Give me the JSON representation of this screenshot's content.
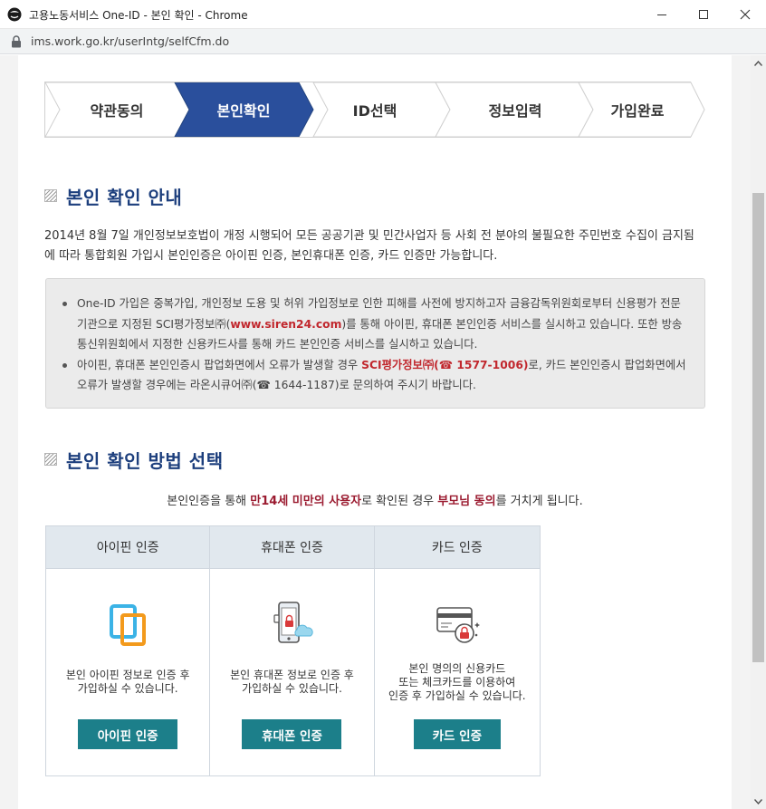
{
  "window": {
    "title": "고용노동서비스 One-ID - 본인 확인 - Chrome",
    "url": "ims.work.go.kr/userIntg/selfCfm.do"
  },
  "steps": [
    {
      "label": "약관동의",
      "active": false
    },
    {
      "label": "본인확인",
      "active": true
    },
    {
      "label": "ID선택",
      "active": false
    },
    {
      "label": "정보입력",
      "active": false
    },
    {
      "label": "가입완료",
      "active": false
    }
  ],
  "section1": {
    "title": "본인 확인 안내",
    "intro": "2014년 8월 7일 개인정보보호법이 개정 시행되어 모든 공공기관 및 민간사업자 등 사회 전 분야의 불필요한 주민번호 수집이 금지됨에 따라 통합회원 가입시 본인인증은 아이핀 인증, 본인휴대폰 인증, 카드 인증만 가능합니다."
  },
  "notice": {
    "item1_a": "One-ID 가입은 중복가입, 개인정보 도용 및 허위 가입정보로 인한 피해를 사전에 방지하고자 금융감독위원회로부터 신용평가 전문기관으로 지정된 SCI평가정보㈜(",
    "item1_link": "www.siren24.com",
    "item1_b": ")를 통해 아이핀, 휴대폰 본인인증 서비스를 실시하고 있습니다. 또한 방송통신위원회에서 지정한 신용카드사를 통해 카드 본인인증 서비스를 실시하고 있습니다.",
    "item2_a": "아이핀, 휴대폰 본인인증시 팝업화면에서 오류가 발생할 경우 ",
    "item2_hl": "SCI평가정보㈜(☎ 1577-1006)",
    "item2_b": "로, 카드 본인인증시 팝업화면에서 오류가 발생할 경우에는 라온시큐어㈜(☎ 1644-1187)로 문의하여 주시기 바랍니다."
  },
  "section2": {
    "title": "본인 확인 방법 선택",
    "note_a": "본인인증을 통해 ",
    "note_hl1": "만14세 미만의 사용자",
    "note_b": "로 확인된 경우 ",
    "note_hl2": "부모님 동의",
    "note_c": "를 거치게 됩니다."
  },
  "methods": [
    {
      "header": "아이핀 인증",
      "icon": "ipin-icon",
      "desc_lines": [
        "본인 아이핀 정보로 인증 후",
        "가입하실 수 있습니다."
      ],
      "button": "아이핀 인증"
    },
    {
      "header": "휴대폰 인증",
      "icon": "mobile-phone-icon",
      "desc_lines": [
        "본인 휴대폰 정보로 인증 후",
        "가입하실 수 있습니다."
      ],
      "button": "휴대폰 인증"
    },
    {
      "header": "카드 인증",
      "icon": "credit-card-icon",
      "desc_lines": [
        "본인 명의의 신용카드",
        "또는 체크카드를 이용하여",
        "인증 후 가입하실 수 있습니다."
      ],
      "button": "카드 인증"
    }
  ],
  "colors": {
    "step_active": "#2a4f9c",
    "accent_button": "#1c7f8a",
    "heading": "#1d3f7d",
    "highlight": "#c1272d"
  }
}
